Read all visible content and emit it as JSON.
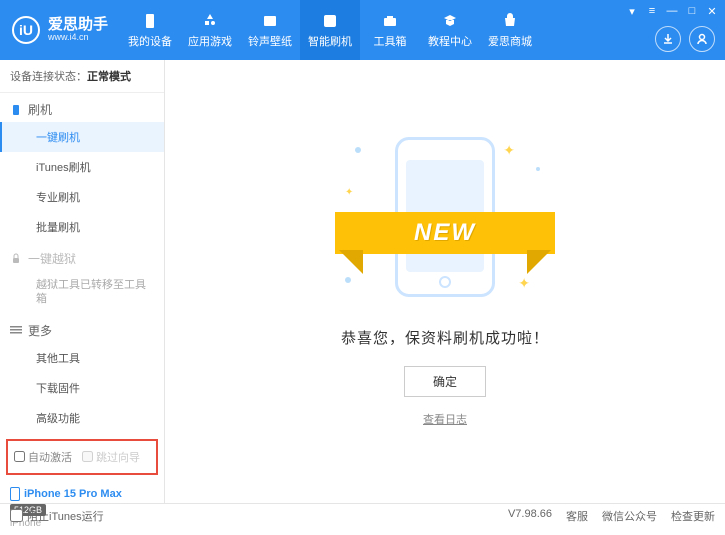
{
  "app": {
    "title": "爱思助手",
    "subtitle": "www.i4.cn"
  },
  "nav": {
    "items": [
      {
        "label": "我的设备"
      },
      {
        "label": "应用游戏"
      },
      {
        "label": "铃声壁纸"
      },
      {
        "label": "智能刷机"
      },
      {
        "label": "工具箱"
      },
      {
        "label": "教程中心"
      },
      {
        "label": "爱思商城"
      }
    ],
    "active_index": 3
  },
  "status": {
    "label": "设备连接状态：",
    "value": "正常模式"
  },
  "sidebar": {
    "flash": {
      "header": "刷机",
      "items": [
        "一键刷机",
        "iTunes刷机",
        "专业刷机",
        "批量刷机"
      ],
      "active_index": 0
    },
    "jailbreak": {
      "header": "一键越狱",
      "note": "越狱工具已转移至工具箱"
    },
    "more": {
      "header": "更多",
      "items": [
        "其他工具",
        "下载固件",
        "高级功能"
      ]
    }
  },
  "checkboxes": {
    "auto_activate": "自动激活",
    "skip_guide": "跳过向导"
  },
  "device": {
    "name": "iPhone 15 Pro Max",
    "storage": "512GB",
    "type": "iPhone"
  },
  "main": {
    "ribbon": "NEW",
    "success": "恭喜您，保资料刷机成功啦！",
    "ok": "确定",
    "view_log": "查看日志"
  },
  "footer": {
    "block_itunes": "阻止iTunes运行",
    "version": "V7.98.66",
    "links": [
      "客服",
      "微信公众号",
      "检查更新"
    ]
  }
}
